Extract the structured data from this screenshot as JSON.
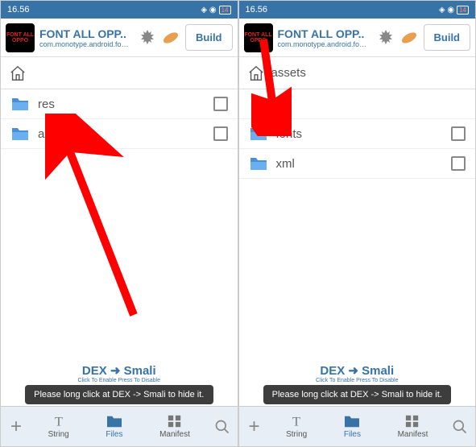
{
  "status": {
    "time": "16.56",
    "battery": "14"
  },
  "header": {
    "title": "FONT ALL OPP..",
    "subtitle": "com.monotype.android.font...",
    "build": "Build",
    "appicon_text": "FONT\nALL\nOPPO"
  },
  "left": {
    "breadcrumb": "",
    "items": [
      {
        "name": "res"
      },
      {
        "name": "assets"
      }
    ]
  },
  "right": {
    "breadcrumb": "assets",
    "items": [
      {
        "name": "fonts"
      },
      {
        "name": "xml"
      }
    ]
  },
  "dex": {
    "main": "DEX ➜ Smali",
    "sub": "Click To Enable    Press To Disable"
  },
  "toast": "Please long click at DEX -> Smali to hide it.",
  "nav": {
    "string": "String",
    "files": "Files",
    "manifest": "Manifest"
  }
}
